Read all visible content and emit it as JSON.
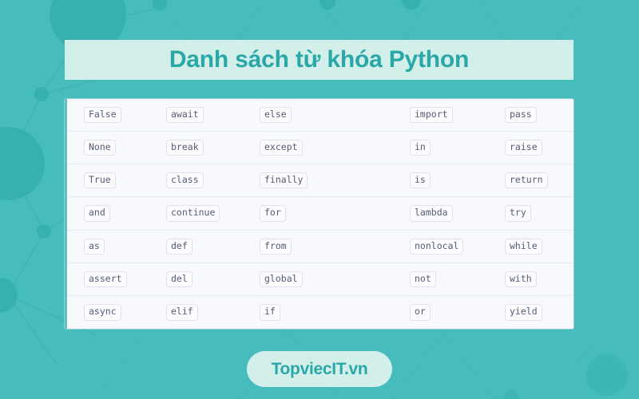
{
  "theme": {
    "background": "#46bcbd",
    "panel_mint": "#d3efe9",
    "accent_teal": "#2aa7a8",
    "table_bg": "#f8f9fc",
    "chip_text": "#545c76",
    "chip_border": "#dfe2ee",
    "row_divider": "#e6e9f2"
  },
  "header": {
    "title": "Danh sách từ khóa Python"
  },
  "footer": {
    "badge_label": "TopviecIT.vn"
  },
  "keywords": {
    "columns": 5,
    "rows": [
      [
        "False",
        "await",
        "else",
        "import",
        "pass"
      ],
      [
        "None",
        "break",
        "except",
        "in",
        "raise"
      ],
      [
        "True",
        "class",
        "finally",
        "is",
        "return"
      ],
      [
        "and",
        "continue",
        "for",
        "lambda",
        "try"
      ],
      [
        "as",
        "def",
        "from",
        "nonlocal",
        "while"
      ],
      [
        "assert",
        "del",
        "global",
        "not",
        "with"
      ],
      [
        "async",
        "elif",
        "if",
        "or",
        "yield"
      ]
    ]
  },
  "decorations": {
    "pattern_name": "network-nodes-circles"
  }
}
